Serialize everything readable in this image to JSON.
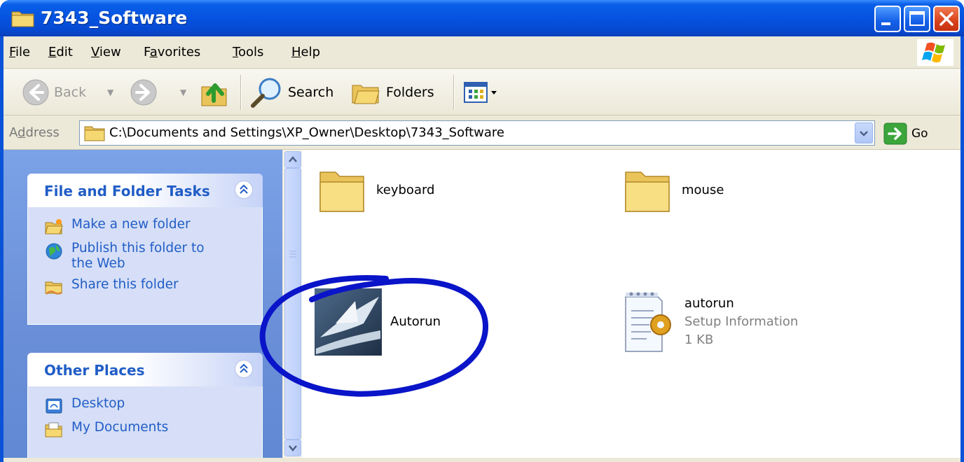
{
  "window": {
    "title": "7343_Software"
  },
  "menu": {
    "items": [
      {
        "label": "File",
        "key": "F",
        "rest": "ile"
      },
      {
        "label": "Edit",
        "key": "E",
        "rest": "dit"
      },
      {
        "label": "View",
        "key": "V",
        "rest": "iew"
      },
      {
        "label": "Favorites",
        "pre": "F",
        "key": "a",
        "rest": "vorites"
      },
      {
        "label": "Tools",
        "key": "T",
        "rest": "ools"
      },
      {
        "label": "Help",
        "key": "H",
        "rest": "elp"
      }
    ]
  },
  "toolbar": {
    "back_label": "Back",
    "search_label": "Search",
    "folders_label": "Folders"
  },
  "address": {
    "label": "Address",
    "label_key": "d",
    "path": "C:\\Documents and Settings\\XP_Owner\\Desktop\\7343_Software",
    "go_label": "Go"
  },
  "taskpane": {
    "file_tasks": {
      "title": "File and Folder Tasks",
      "items": [
        {
          "label": "Make a new folder",
          "icon": "new-folder-icon"
        },
        {
          "label_line1": "Publish this folder to",
          "label_line2": "the Web",
          "icon": "globe-icon"
        },
        {
          "label": "Share this folder",
          "icon": "share-folder-icon"
        }
      ]
    },
    "other_places": {
      "title": "Other Places",
      "items": [
        {
          "label": "Desktop",
          "icon": "desktop-icon"
        },
        {
          "label": "My Documents",
          "icon": "my-documents-icon"
        }
      ]
    }
  },
  "files": [
    {
      "name": "keyboard",
      "type": "folder"
    },
    {
      "name": "mouse",
      "type": "folder"
    },
    {
      "name": "Autorun",
      "type": "application"
    },
    {
      "name": "autorun",
      "type_label": "Setup Information",
      "size": "1 KB"
    }
  ],
  "annotation": {
    "color": "#0a14c8"
  }
}
